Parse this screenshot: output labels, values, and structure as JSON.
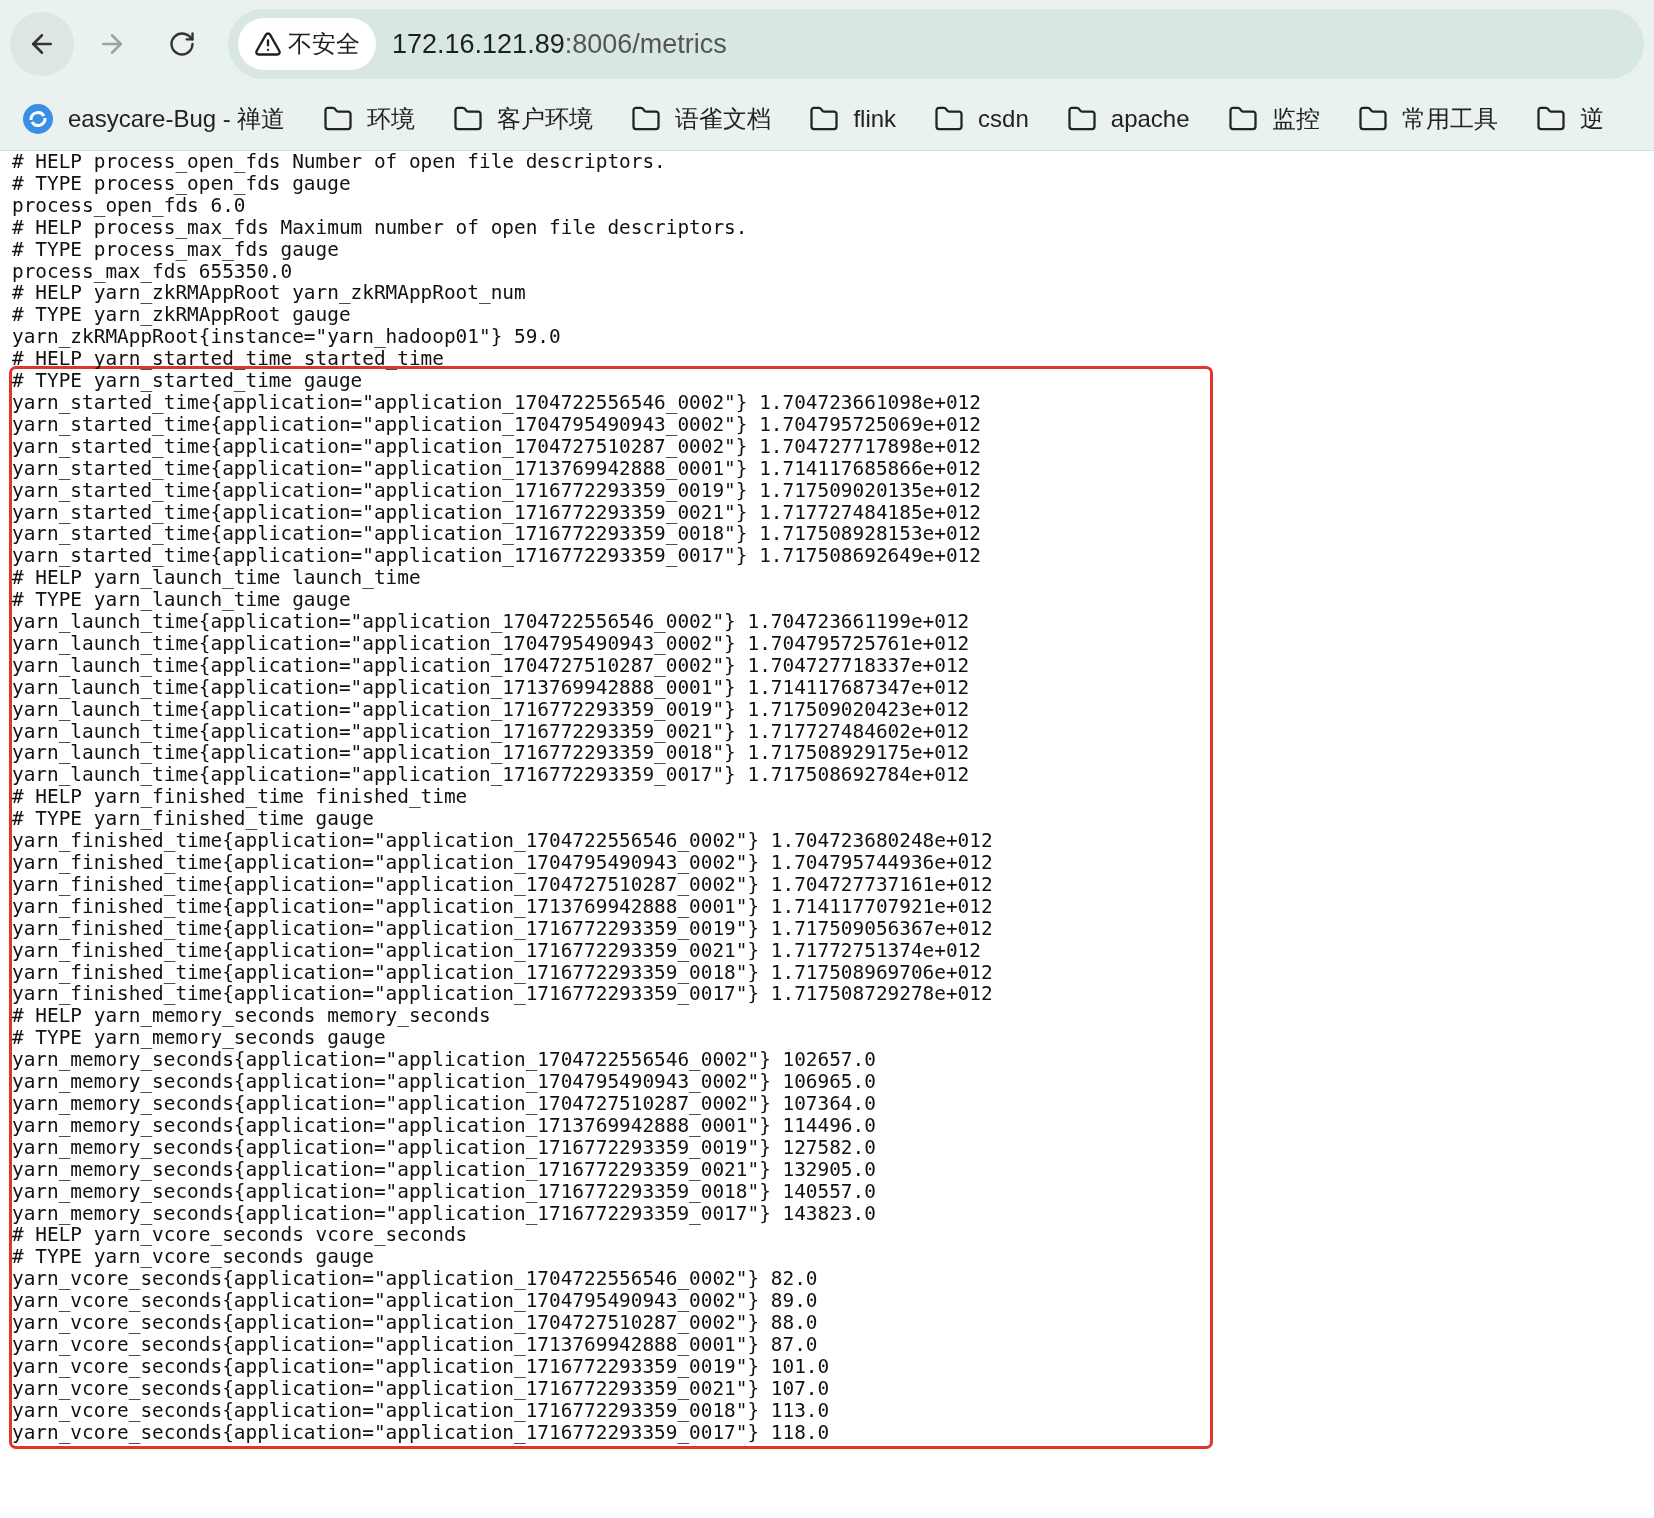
{
  "toolbar": {
    "security_label": "不安全",
    "url_host": "172.16.121.89",
    "url_path": ":8006/metrics"
  },
  "bookmarks": [
    {
      "kind": "site",
      "label": "easycare-Bug - 禅道"
    },
    {
      "kind": "folder",
      "label": "环境"
    },
    {
      "kind": "folder",
      "label": "客户环境"
    },
    {
      "kind": "folder",
      "label": "语雀文档"
    },
    {
      "kind": "folder",
      "label": "flink"
    },
    {
      "kind": "folder",
      "label": "csdn"
    },
    {
      "kind": "folder",
      "label": "apache"
    },
    {
      "kind": "folder",
      "label": "监控"
    },
    {
      "kind": "folder",
      "label": "常用工具"
    },
    {
      "kind": "folder",
      "label": "逆"
    }
  ],
  "metrics": {
    "lines": [
      "# HELP process_open_fds Number of open file descriptors.",
      "# TYPE process_open_fds gauge",
      "process_open_fds 6.0",
      "# HELP process_max_fds Maximum number of open file descriptors.",
      "# TYPE process_max_fds gauge",
      "process_max_fds 655350.0",
      "# HELP yarn_zkRMAppRoot yarn_zkRMAppRoot_num",
      "# TYPE yarn_zkRMAppRoot gauge",
      "yarn_zkRMAppRoot{instance=\"yarn_hadoop01\"} 59.0",
      "# HELP yarn_started_time started_time"
    ],
    "highlighted_lines": [
      "# TYPE yarn_started_time gauge",
      "yarn_started_time{application=\"application_1704722556546_0002\"} 1.704723661098e+012",
      "yarn_started_time{application=\"application_1704795490943_0002\"} 1.704795725069e+012",
      "yarn_started_time{application=\"application_1704727510287_0002\"} 1.704727717898e+012",
      "yarn_started_time{application=\"application_1713769942888_0001\"} 1.714117685866e+012",
      "yarn_started_time{application=\"application_1716772293359_0019\"} 1.717509020135e+012",
      "yarn_started_time{application=\"application_1716772293359_0021\"} 1.717727484185e+012",
      "yarn_started_time{application=\"application_1716772293359_0018\"} 1.717508928153e+012",
      "yarn_started_time{application=\"application_1716772293359_0017\"} 1.717508692649e+012",
      "# HELP yarn_launch_time launch_time",
      "# TYPE yarn_launch_time gauge",
      "yarn_launch_time{application=\"application_1704722556546_0002\"} 1.704723661199e+012",
      "yarn_launch_time{application=\"application_1704795490943_0002\"} 1.704795725761e+012",
      "yarn_launch_time{application=\"application_1704727510287_0002\"} 1.704727718337e+012",
      "yarn_launch_time{application=\"application_1713769942888_0001\"} 1.714117687347e+012",
      "yarn_launch_time{application=\"application_1716772293359_0019\"} 1.717509020423e+012",
      "yarn_launch_time{application=\"application_1716772293359_0021\"} 1.717727484602e+012",
      "yarn_launch_time{application=\"application_1716772293359_0018\"} 1.717508929175e+012",
      "yarn_launch_time{application=\"application_1716772293359_0017\"} 1.717508692784e+012",
      "# HELP yarn_finished_time finished_time",
      "# TYPE yarn_finished_time gauge",
      "yarn_finished_time{application=\"application_1704722556546_0002\"} 1.704723680248e+012",
      "yarn_finished_time{application=\"application_1704795490943_0002\"} 1.704795744936e+012",
      "yarn_finished_time{application=\"application_1704727510287_0002\"} 1.704727737161e+012",
      "yarn_finished_time{application=\"application_1713769942888_0001\"} 1.714117707921e+012",
      "yarn_finished_time{application=\"application_1716772293359_0019\"} 1.717509056367e+012",
      "yarn_finished_time{application=\"application_1716772293359_0021\"} 1.71772751374e+012",
      "yarn_finished_time{application=\"application_1716772293359_0018\"} 1.717508969706e+012",
      "yarn_finished_time{application=\"application_1716772293359_0017\"} 1.717508729278e+012",
      "# HELP yarn_memory_seconds memory_seconds",
      "# TYPE yarn_memory_seconds gauge",
      "yarn_memory_seconds{application=\"application_1704722556546_0002\"} 102657.0",
      "yarn_memory_seconds{application=\"application_1704795490943_0002\"} 106965.0",
      "yarn_memory_seconds{application=\"application_1704727510287_0002\"} 107364.0",
      "yarn_memory_seconds{application=\"application_1713769942888_0001\"} 114496.0",
      "yarn_memory_seconds{application=\"application_1716772293359_0019\"} 127582.0",
      "yarn_memory_seconds{application=\"application_1716772293359_0021\"} 132905.0",
      "yarn_memory_seconds{application=\"application_1716772293359_0018\"} 140557.0",
      "yarn_memory_seconds{application=\"application_1716772293359_0017\"} 143823.0",
      "# HELP yarn_vcore_seconds vcore_seconds",
      "# TYPE yarn_vcore_seconds gauge",
      "yarn_vcore_seconds{application=\"application_1704722556546_0002\"} 82.0",
      "yarn_vcore_seconds{application=\"application_1704795490943_0002\"} 89.0",
      "yarn_vcore_seconds{application=\"application_1704727510287_0002\"} 88.0",
      "yarn_vcore_seconds{application=\"application_1713769942888_0001\"} 87.0",
      "yarn_vcore_seconds{application=\"application_1716772293359_0019\"} 101.0",
      "yarn_vcore_seconds{application=\"application_1716772293359_0021\"} 107.0",
      "yarn_vcore_seconds{application=\"application_1716772293359_0018\"} 113.0",
      "yarn_vcore_seconds{application=\"application_1716772293359_0017\"} 118.0"
    ]
  }
}
